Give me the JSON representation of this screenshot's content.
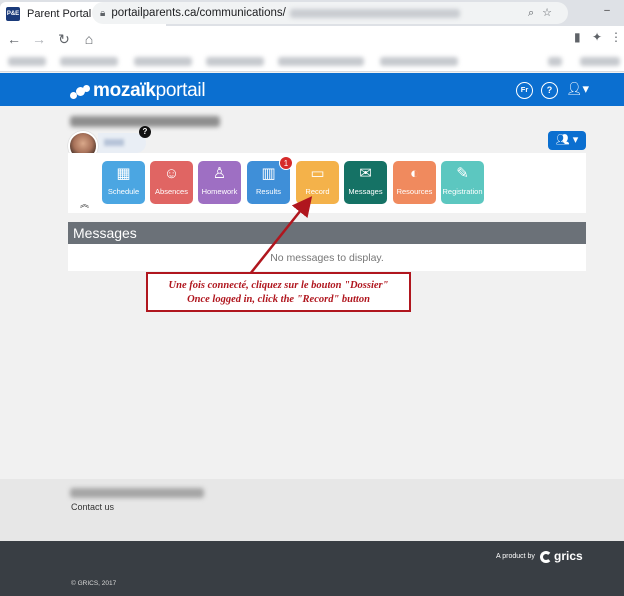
{
  "browser": {
    "tab_title": "Parent Portal",
    "tab_close": "✕",
    "new_tab": "+",
    "url": "portailparents.ca/communications/",
    "favicon_text": "P&E"
  },
  "portal": {
    "logo_bold": "mozaïk",
    "logo_light": "portail",
    "lang_button": "Fr",
    "help_button": "?",
    "child_help_badge": "?"
  },
  "tiles": [
    {
      "label": "Schedule",
      "icon": "calendar-icon",
      "glyph": "▦",
      "color": "#4ba6e2"
    },
    {
      "label": "Absences",
      "icon": "person-icon",
      "glyph": "☺",
      "color": "#e06563"
    },
    {
      "label": "Homework",
      "icon": "person-study-icon",
      "glyph": "♙",
      "color": "#9e6fc3"
    },
    {
      "label": "Results",
      "icon": "bar-chart-icon",
      "glyph": "▥",
      "color": "#3f8fd8"
    },
    {
      "label": "Record",
      "icon": "folder-icon",
      "glyph": "▭",
      "color": "#f4b24a"
    },
    {
      "label": "Messages",
      "icon": "message-icon",
      "glyph": "✉",
      "color": "#157265"
    },
    {
      "label": "Resources",
      "icon": "resource-icon",
      "glyph": "◐",
      "color": "#f08a5e"
    },
    {
      "label": "Registration",
      "icon": "form-icon",
      "glyph": "✎",
      "color": "#5cc7c0"
    }
  ],
  "results_badge": "1",
  "messages": {
    "title": "Messages",
    "empty": "No messages to display."
  },
  "callout": {
    "line_fr": "Une fois connecté, cliquez sur le bouton \"Dossier\"",
    "line_en": "Once logged in, click the \"Record\" button"
  },
  "footer": {
    "contact": "Contact us",
    "product_by": "A product by",
    "brand": "grics",
    "copyright": "© GRICS, 2017"
  },
  "colors": {
    "header_blue": "#0b6fd0",
    "callout_red": "#b0161e",
    "footer_dark": "#393e44"
  }
}
